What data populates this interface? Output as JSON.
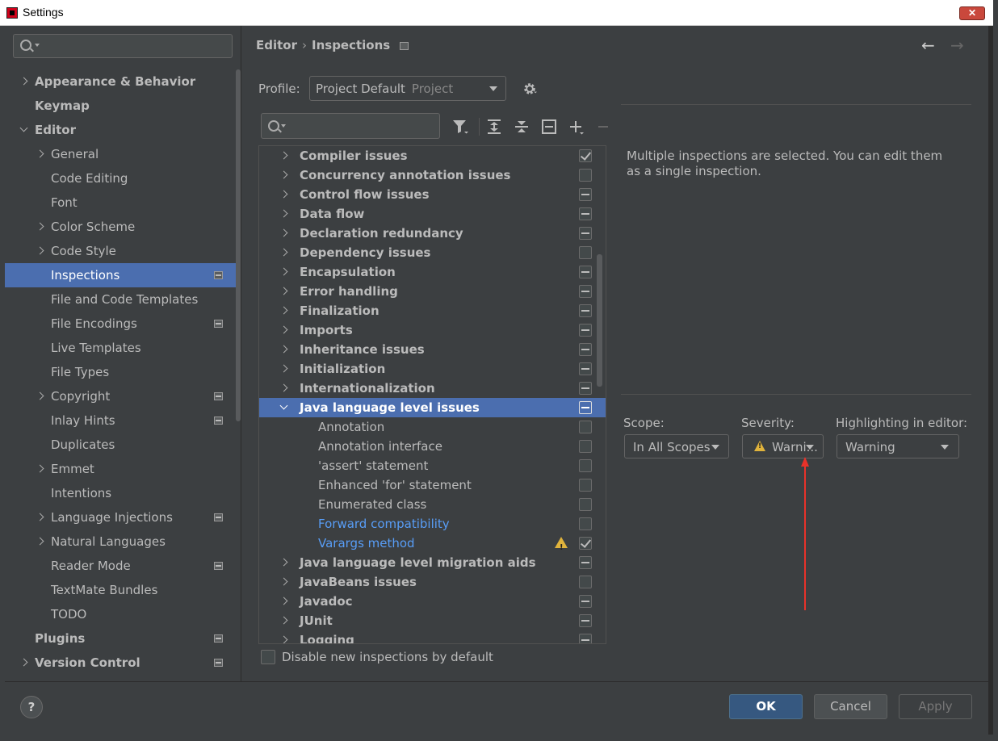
{
  "window": {
    "title": "Settings",
    "close_label": "✕"
  },
  "sidebar": {
    "search_placeholder": "",
    "items": [
      {
        "label": "Appearance & Behavior",
        "level": 0,
        "chevron": "closed",
        "bold": true,
        "project": false
      },
      {
        "label": "Keymap",
        "level": 0,
        "chevron": "none",
        "bold": true,
        "project": false
      },
      {
        "label": "Editor",
        "level": 0,
        "chevron": "open",
        "bold": true,
        "project": false
      },
      {
        "label": "General",
        "level": 1,
        "chevron": "closed",
        "bold": false,
        "project": false
      },
      {
        "label": "Code Editing",
        "level": 1,
        "chevron": "none",
        "bold": false,
        "project": false
      },
      {
        "label": "Font",
        "level": 1,
        "chevron": "none",
        "bold": false,
        "project": false
      },
      {
        "label": "Color Scheme",
        "level": 1,
        "chevron": "closed",
        "bold": false,
        "project": false
      },
      {
        "label": "Code Style",
        "level": 1,
        "chevron": "closed",
        "bold": false,
        "project": false
      },
      {
        "label": "Inspections",
        "level": 1,
        "chevron": "none",
        "bold": false,
        "project": true,
        "selected": true
      },
      {
        "label": "File and Code Templates",
        "level": 1,
        "chevron": "none",
        "bold": false,
        "project": false
      },
      {
        "label": "File Encodings",
        "level": 1,
        "chevron": "none",
        "bold": false,
        "project": true
      },
      {
        "label": "Live Templates",
        "level": 1,
        "chevron": "none",
        "bold": false,
        "project": false
      },
      {
        "label": "File Types",
        "level": 1,
        "chevron": "none",
        "bold": false,
        "project": false
      },
      {
        "label": "Copyright",
        "level": 1,
        "chevron": "closed",
        "bold": false,
        "project": true
      },
      {
        "label": "Inlay Hints",
        "level": 1,
        "chevron": "none",
        "bold": false,
        "project": true
      },
      {
        "label": "Duplicates",
        "level": 1,
        "chevron": "none",
        "bold": false,
        "project": false
      },
      {
        "label": "Emmet",
        "level": 1,
        "chevron": "closed",
        "bold": false,
        "project": false
      },
      {
        "label": "Intentions",
        "level": 1,
        "chevron": "none",
        "bold": false,
        "project": false
      },
      {
        "label": "Language Injections",
        "level": 1,
        "chevron": "closed",
        "bold": false,
        "project": true
      },
      {
        "label": "Natural Languages",
        "level": 1,
        "chevron": "closed",
        "bold": false,
        "project": false
      },
      {
        "label": "Reader Mode",
        "level": 1,
        "chevron": "none",
        "bold": false,
        "project": true
      },
      {
        "label": "TextMate Bundles",
        "level": 1,
        "chevron": "none",
        "bold": false,
        "project": false
      },
      {
        "label": "TODO",
        "level": 1,
        "chevron": "none",
        "bold": false,
        "project": false
      },
      {
        "label": "Plugins",
        "level": 0,
        "chevron": "none",
        "bold": true,
        "project": true
      },
      {
        "label": "Version Control",
        "level": 0,
        "chevron": "closed",
        "bold": true,
        "project": true
      }
    ]
  },
  "header": {
    "breadcrumb": [
      "Editor",
      "Inspections"
    ],
    "breadcrumb_separator": "›",
    "back_icon": "←",
    "forward_icon": "→"
  },
  "profile": {
    "label": "Profile:",
    "value": "Project Default",
    "sub": "Project"
  },
  "toolbar": {
    "icons": [
      "filter-icon",
      "expand-all-icon",
      "collapse-all-icon",
      "reset-icon",
      "add-icon",
      "remove-icon"
    ]
  },
  "tree": {
    "rows": [
      {
        "label": "Compiler issues",
        "type": "group",
        "check": "checked"
      },
      {
        "label": "Concurrency annotation issues",
        "type": "group",
        "check": "empty"
      },
      {
        "label": "Control flow issues",
        "type": "group",
        "check": "partial"
      },
      {
        "label": "Data flow",
        "type": "group",
        "check": "partial"
      },
      {
        "label": "Declaration redundancy",
        "type": "group",
        "check": "partial"
      },
      {
        "label": "Dependency issues",
        "type": "group",
        "check": "empty"
      },
      {
        "label": "Encapsulation",
        "type": "group",
        "check": "partial"
      },
      {
        "label": "Error handling",
        "type": "group",
        "check": "partial"
      },
      {
        "label": "Finalization",
        "type": "group",
        "check": "partial"
      },
      {
        "label": "Imports",
        "type": "group",
        "check": "partial"
      },
      {
        "label": "Inheritance issues",
        "type": "group",
        "check": "partial"
      },
      {
        "label": "Initialization",
        "type": "group",
        "check": "partial"
      },
      {
        "label": "Internationalization",
        "type": "group",
        "check": "partial"
      },
      {
        "label": "Java language level issues",
        "type": "group",
        "check": "partial",
        "selected": true
      },
      {
        "label": "Annotation",
        "type": "child",
        "check": "empty"
      },
      {
        "label": "Annotation interface",
        "type": "child",
        "check": "empty"
      },
      {
        "label": "'assert' statement",
        "type": "child",
        "check": "empty"
      },
      {
        "label": "Enhanced 'for' statement",
        "type": "child",
        "check": "empty"
      },
      {
        "label": "Enumerated class",
        "type": "child",
        "check": "empty"
      },
      {
        "label": "Forward compatibility",
        "type": "child",
        "check": "empty",
        "link": true
      },
      {
        "label": "Varargs method",
        "type": "child",
        "check": "checked",
        "link": true,
        "warn": true
      },
      {
        "label": "Java language level migration aids",
        "type": "group",
        "check": "partial"
      },
      {
        "label": "JavaBeans issues",
        "type": "group",
        "check": "empty"
      },
      {
        "label": "Javadoc",
        "type": "group",
        "check": "partial"
      },
      {
        "label": "JUnit",
        "type": "group",
        "check": "partial"
      },
      {
        "label": "Logging",
        "type": "group",
        "check": "partial"
      }
    ]
  },
  "disable_new": {
    "label": "Disable new inspections by default",
    "checked": false
  },
  "description": "Multiple inspections are selected. You can edit them as a single inspection.",
  "options": {
    "scope_label": "Scope:",
    "scope_value": "In All Scopes",
    "severity_label": "Severity:",
    "severity_value": "Warni...",
    "highlighting_label": "Highlighting in editor:",
    "highlighting_value": "Warning"
  },
  "buttons": {
    "help": "?",
    "ok": "OK",
    "cancel": "Cancel",
    "apply": "Apply"
  },
  "colors": {
    "accent": "#4b6eaf",
    "link": "#589df6",
    "warning": "#e0b33c",
    "annotation_arrow": "#e8322a"
  }
}
